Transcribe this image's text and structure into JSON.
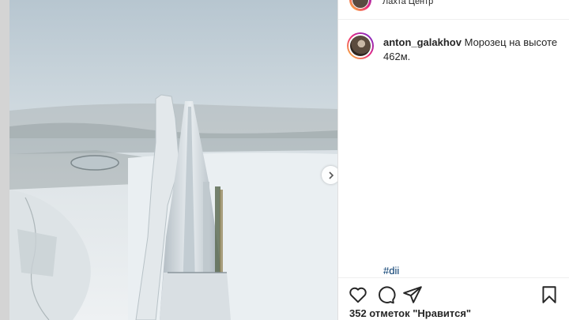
{
  "post": {
    "location": "Лахта Центр",
    "author": "anton_galakhov",
    "caption": "Морозец на высоте 462м.",
    "hashtag": "#dii",
    "likes_text": "352 отметок \"Нравится\""
  },
  "icons": {
    "like": "heart-icon",
    "comment": "comment-icon",
    "share": "paper-plane-icon",
    "save": "bookmark-icon",
    "next": "chevron-right-icon"
  },
  "colors": {
    "hashtag": "#00376b",
    "text": "#262626",
    "sky": "#c9d6df",
    "snow": "#e8eef2"
  }
}
